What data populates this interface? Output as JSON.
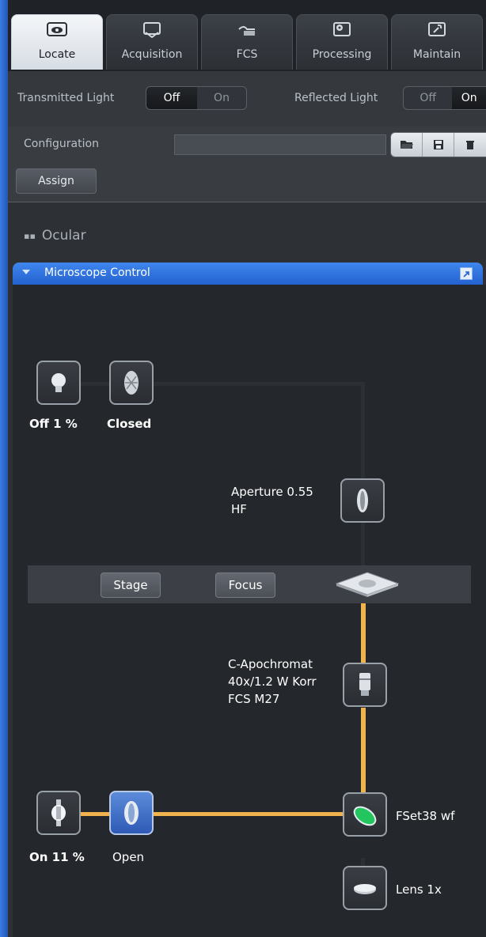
{
  "tabs": [
    {
      "label": "Locate",
      "icon": "eye-icon",
      "active": true
    },
    {
      "label": "Acquisition",
      "icon": "acquisition-icon",
      "active": false
    },
    {
      "label": "FCS",
      "icon": "fcs-icon",
      "active": false
    },
    {
      "label": "Processing",
      "icon": "gear-icon",
      "active": false
    },
    {
      "label": "Maintain",
      "icon": "wrench-icon",
      "active": false
    }
  ],
  "light": {
    "transmitted_label": "Transmitted Light",
    "transmitted_off": "Off",
    "transmitted_on": "On",
    "transmitted_selected": "Off",
    "reflected_label": "Reflected Light",
    "reflected_off": "Off",
    "reflected_on": "On",
    "reflected_selected": "On"
  },
  "configuration": {
    "label": "Configuration",
    "value": "",
    "tools": [
      "folder-open-icon",
      "save-icon",
      "delete-icon"
    ]
  },
  "assign_label": "Assign",
  "ocular_label": "Ocular",
  "panel": {
    "title": "Microscope Control"
  },
  "microscope": {
    "halogen_status": "Off 1 %",
    "shutter_top_status": "Closed",
    "condenser_label": "Aperture 0.55\nHF",
    "condenser_label_line1": "Aperture 0.55",
    "condenser_label_line2": "HF",
    "stage_button": "Stage",
    "focus_button": "Focus",
    "objective_line1": "C-Apochromat",
    "objective_line2": "40x/1.2 W Korr",
    "objective_line3": "FCS M27",
    "reflector_label": "FSet38 wf",
    "tubelens_label": "Lens 1x",
    "hbo_status": "On 11 %",
    "shutter_bottom_status": "Open"
  },
  "colors": {
    "accent": "#2f6fd8",
    "light_path": "#f1b34d",
    "panel_bg": "#24272b"
  }
}
